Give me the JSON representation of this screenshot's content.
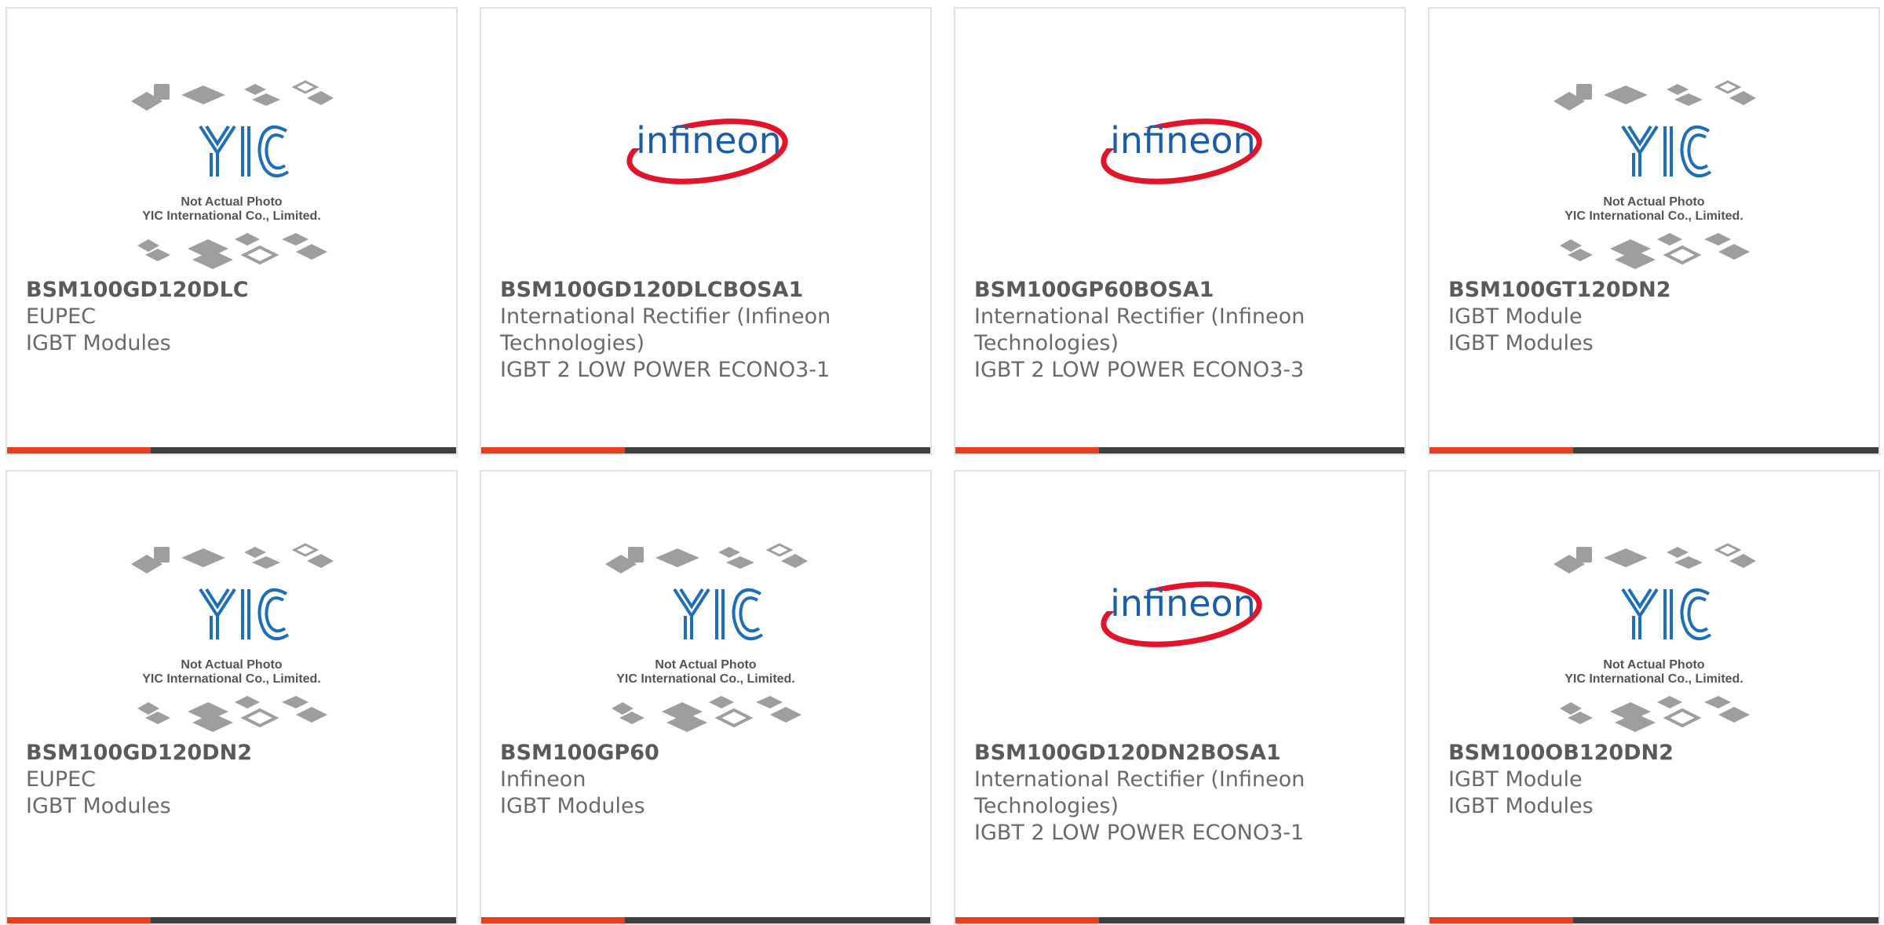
{
  "accent_color": "#e8401a",
  "bar_color": "#3f3f3f",
  "placeholder": {
    "logo": "YIC",
    "line1": "Not Actual Photo",
    "line2": "YIC International Co., Limited."
  },
  "infineon_logo": "infineon",
  "products": [
    {
      "part": "BSM100GD120DLC",
      "line2": "EUPEC",
      "line3": "IGBT Modules",
      "line4": "",
      "image": "yic-placeholder"
    },
    {
      "part": "BSM100GD120DLCBOSA1",
      "line2": "International Rectifier (Infineon",
      "line3": "Technologies)",
      "line4": "IGBT 2 LOW POWER ECONO3-1",
      "image": "infineon-logo"
    },
    {
      "part": "BSM100GP60BOSA1",
      "line2": "International Rectifier (Infineon",
      "line3": "Technologies)",
      "line4": "IGBT 2 LOW POWER ECONO3-3",
      "image": "infineon-logo"
    },
    {
      "part": "BSM100GT120DN2",
      "line2": "IGBT Module",
      "line3": "IGBT Modules",
      "line4": "",
      "image": "yic-placeholder"
    },
    {
      "part": "BSM100GD120DN2",
      "line2": "EUPEC",
      "line3": "IGBT Modules",
      "line4": "",
      "image": "yic-placeholder"
    },
    {
      "part": "BSM100GP60",
      "line2": "Infineon",
      "line3": "IGBT Modules",
      "line4": "",
      "image": "yic-placeholder"
    },
    {
      "part": "BSM100GD120DN2BOSA1",
      "line2": "International Rectifier (Infineon",
      "line3": "Technologies)",
      "line4": "IGBT 2 LOW POWER ECONO3-1",
      "image": "infineon-logo"
    },
    {
      "part": "BSM100OB120DN2",
      "line2": "IGBT Module",
      "line3": "IGBT Modules",
      "line4": "",
      "image": "yic-placeholder"
    }
  ]
}
